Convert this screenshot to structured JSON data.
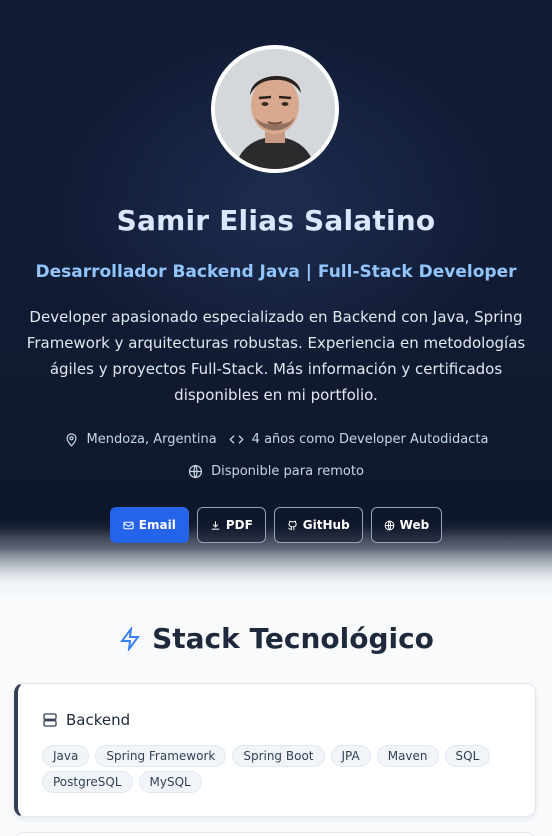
{
  "profile": {
    "name": "Samir Elias Salatino",
    "role": "Desarrollador Backend Java | Full-Stack Developer",
    "bio": "Developer apasionado especializado en Backend con Java, Spring Framework y arquitecturas robustas. Experiencia en metodologías ágiles y proyectos Full-Stack. Más información y certificados disponibles en mi portfolio.",
    "location": "Mendoza, Argentina",
    "experience": "4 años como Developer Autodidacta",
    "availability": "Disponible para remoto"
  },
  "buttons": {
    "email": "Email",
    "pdf": "PDF",
    "github": "GitHub",
    "web": "Web"
  },
  "stack": {
    "title": "Stack Tecnológico",
    "backend": {
      "title": "Backend",
      "tags": [
        "Java",
        "Spring Framework",
        "Spring Boot",
        "JPA",
        "Maven",
        "SQL",
        "PostgreSQL",
        "MySQL"
      ]
    }
  },
  "colors": {
    "accent": "#2563eb",
    "hero_bg": "#0f172a",
    "role_text": "#93c5fd"
  },
  "icons": [
    "map-pin-icon",
    "code-icon",
    "globe-icon",
    "mail-icon",
    "download-icon",
    "github-icon",
    "zap-icon",
    "server-icon"
  ]
}
